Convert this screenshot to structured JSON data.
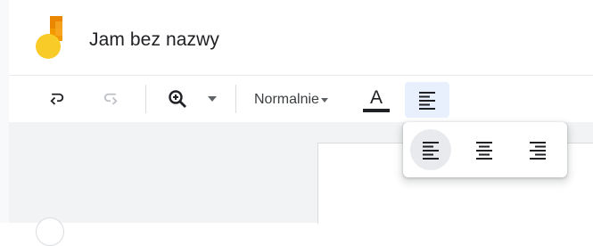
{
  "document": {
    "title": "Jam bez nazwy"
  },
  "toolbar": {
    "undo_icon": "undo-icon",
    "redo_icon": "redo-icon",
    "zoom_icon": "zoom-in-icon",
    "style_value": "Normalnie",
    "text_color_letter": "A",
    "text_color": "#202124",
    "align_icon": "align-left-icon"
  },
  "align_menu": {
    "options": [
      {
        "icon": "align-left-icon",
        "selected": true
      },
      {
        "icon": "align-center-icon",
        "selected": false
      },
      {
        "icon": "align-right-icon",
        "selected": false
      }
    ]
  },
  "colors": {
    "logo_yellow": "#F9CB28",
    "logo_orange": "#F29900",
    "logo_red_orange": "#EA8600",
    "active_button_bg": "#e8f0fe"
  }
}
